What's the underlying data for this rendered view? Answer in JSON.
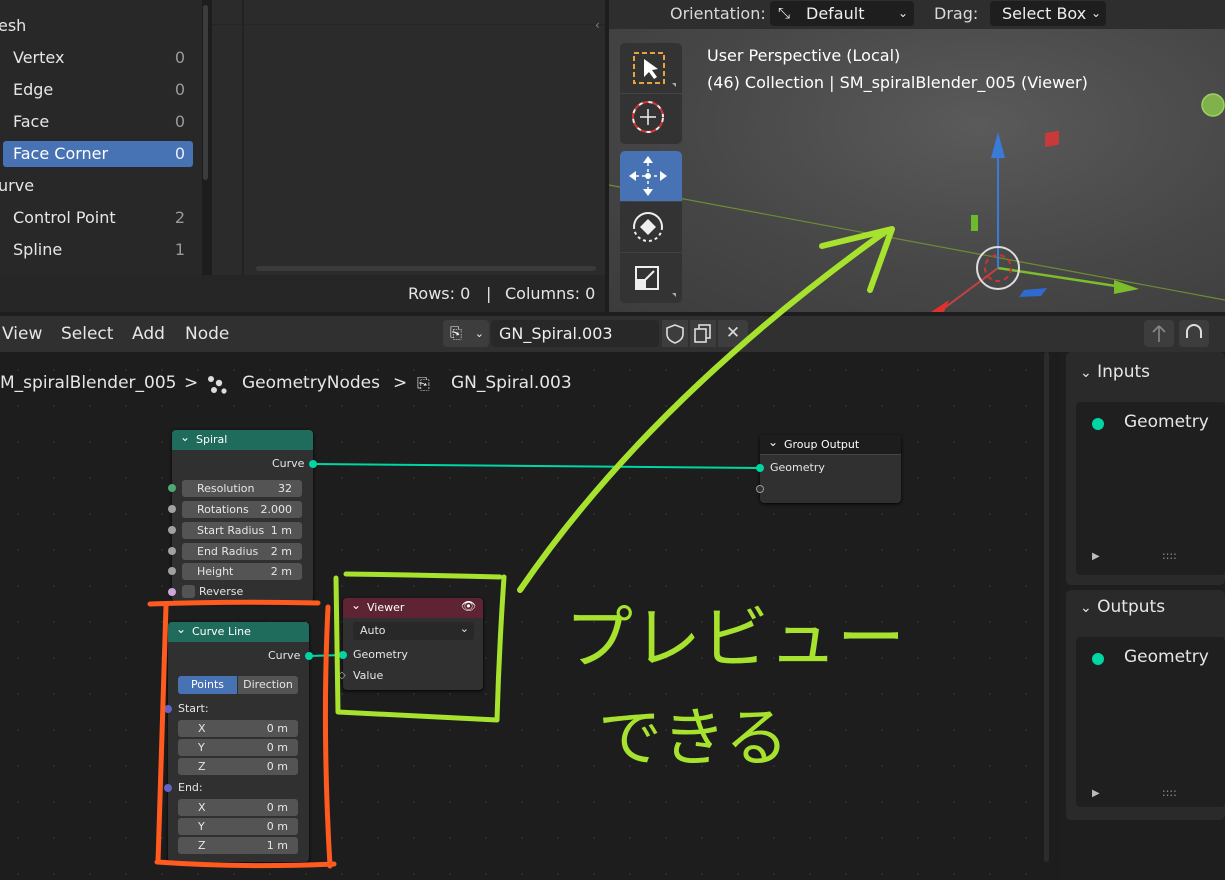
{
  "spreadsheet": {
    "tree": [
      {
        "label": "esh",
        "count": "",
        "header": true
      },
      {
        "label": "Vertex",
        "count": "0"
      },
      {
        "label": "Edge",
        "count": "0"
      },
      {
        "label": "Face",
        "count": "0"
      },
      {
        "label": "Face Corner",
        "count": "0",
        "selected": true
      },
      {
        "label": "urve",
        "count": "",
        "header": true
      },
      {
        "label": "Control Point",
        "count": "2"
      },
      {
        "label": "Spline",
        "count": "1"
      }
    ],
    "rows_label": "Rows: 0",
    "separator": "|",
    "columns_label": "Columns: 0"
  },
  "viewport": {
    "orientation_label": "Orientation:",
    "orientation_value": "Default",
    "drag_label": "Drag:",
    "drag_value": "Select Box",
    "overlay_line1": "User Perspective (Local)",
    "overlay_line2": "(46) Collection | SM_spiralBlender_005 (Viewer)",
    "tools": [
      "select-box-icon",
      "cursor-icon",
      "move-icon",
      "rotate-icon",
      "scale-icon"
    ]
  },
  "node_editor": {
    "menus": [
      "View",
      "Select",
      "Add",
      "Node"
    ],
    "node_group_name": "GN_Spiral.003",
    "breadcrumb": [
      "M_spiralBlender_005",
      "GeometryNodes",
      "GN_Spiral.003"
    ],
    "breadcrumb_sep": ">"
  },
  "nodes": {
    "spiral": {
      "title": "Spiral",
      "output": "Curve",
      "fields": [
        {
          "label": "Resolution",
          "value": "32"
        },
        {
          "label": "Rotations",
          "value": "2.000"
        },
        {
          "label": "Start Radius",
          "value": "1 m"
        },
        {
          "label": "End Radius",
          "value": "2 m"
        },
        {
          "label": "Height",
          "value": "2 m"
        }
      ],
      "reverse_label": "Reverse"
    },
    "group_output": {
      "title": "Group Output",
      "input": "Geometry"
    },
    "viewer": {
      "title": "Viewer",
      "mode": "Auto",
      "inputs": [
        "Geometry",
        "Value"
      ]
    },
    "curve_line": {
      "title": "Curve Line",
      "output": "Curve",
      "mode_options": [
        "Points",
        "Direction"
      ],
      "mode_selected": "Points",
      "start_label": "Start:",
      "start": [
        {
          "label": "X",
          "value": "0 m"
        },
        {
          "label": "Y",
          "value": "0 m"
        },
        {
          "label": "Z",
          "value": "0 m"
        }
      ],
      "end_label": "End:",
      "end": [
        {
          "label": "X",
          "value": "0 m"
        },
        {
          "label": "Y",
          "value": "0 m"
        },
        {
          "label": "Z",
          "value": "1 m"
        }
      ]
    }
  },
  "side_panel": {
    "inputs_title": "Inputs",
    "inputs_item": "Geometry",
    "outputs_title": "Outputs",
    "outputs_item": "Geometry",
    "handle": "::::"
  },
  "annotation": {
    "line1": "プレビュー",
    "line2": "できる",
    "color": "#a6e22e",
    "box_color": "#ff5a1f"
  },
  "colors": {
    "accent": "#4772b3",
    "geometry_socket": "#00d6a3",
    "spiral_header": "#1f6b5c",
    "viewer_header": "#5e2433"
  }
}
